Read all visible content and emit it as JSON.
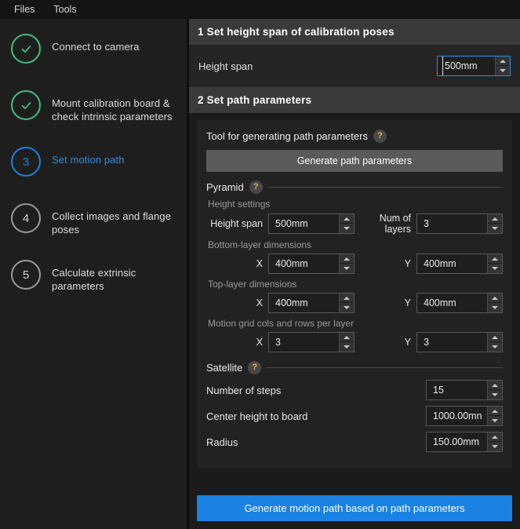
{
  "menubar": {
    "items": [
      {
        "label": "Files"
      },
      {
        "label": "Tools"
      }
    ]
  },
  "sidebar": {
    "steps": [
      {
        "marker": "✓",
        "label": "Connect to camera",
        "state": "done"
      },
      {
        "marker": "✓",
        "label": "Mount calibration board & check intrinsic parameters",
        "state": "done"
      },
      {
        "marker": "3",
        "label": "Set motion path",
        "state": "active"
      },
      {
        "marker": "4",
        "label": "Collect images and flange poses",
        "state": "pending"
      },
      {
        "marker": "5",
        "label": "Calculate extrinsic parameters",
        "state": "pending"
      }
    ]
  },
  "section1": {
    "header": "1 Set height span of calibration poses",
    "height_span_label": "Height span",
    "height_span_value": "500mm"
  },
  "section2": {
    "header": "2 Set path parameters",
    "tool_label": "Tool for generating path parameters",
    "help_glyph": "?",
    "generate_params_button": "Generate path parameters",
    "pyramid": {
      "title": "Pyramid",
      "height_settings_label": "Height settings",
      "height_span_label": "Height span",
      "height_span_value": "500mm",
      "num_layers_label": "Num of layers",
      "num_layers_value": "3",
      "bottom_layer_label": "Bottom-layer dimensions",
      "bottom_x_label": "X",
      "bottom_x_value": "400mm",
      "bottom_y_label": "Y",
      "bottom_y_value": "400mm",
      "top_layer_label": "Top-layer dimensions",
      "top_x_label": "X",
      "top_x_value": "400mm",
      "top_y_label": "Y",
      "top_y_value": "400mm",
      "grid_label": "Motion grid cols and rows per layer",
      "grid_x_label": "X",
      "grid_x_value": "3",
      "grid_y_label": "Y",
      "grid_y_value": "3"
    },
    "satellite": {
      "title": "Satellite",
      "steps_label": "Number of steps",
      "steps_value": "15",
      "center_height_label": "Center height to board",
      "center_height_value": "1000.00mn",
      "radius_label": "Radius",
      "radius_value": "150.00mm"
    }
  },
  "footer": {
    "generate_path_button": "Generate motion path based on path parameters"
  },
  "colors": {
    "accent_blue": "#1a82e2",
    "done_green": "#3ebd87",
    "pending_gray": "#9a9a9a",
    "help_yellow": "#e8b44a",
    "section_header_bg": "#3a3a3a"
  }
}
